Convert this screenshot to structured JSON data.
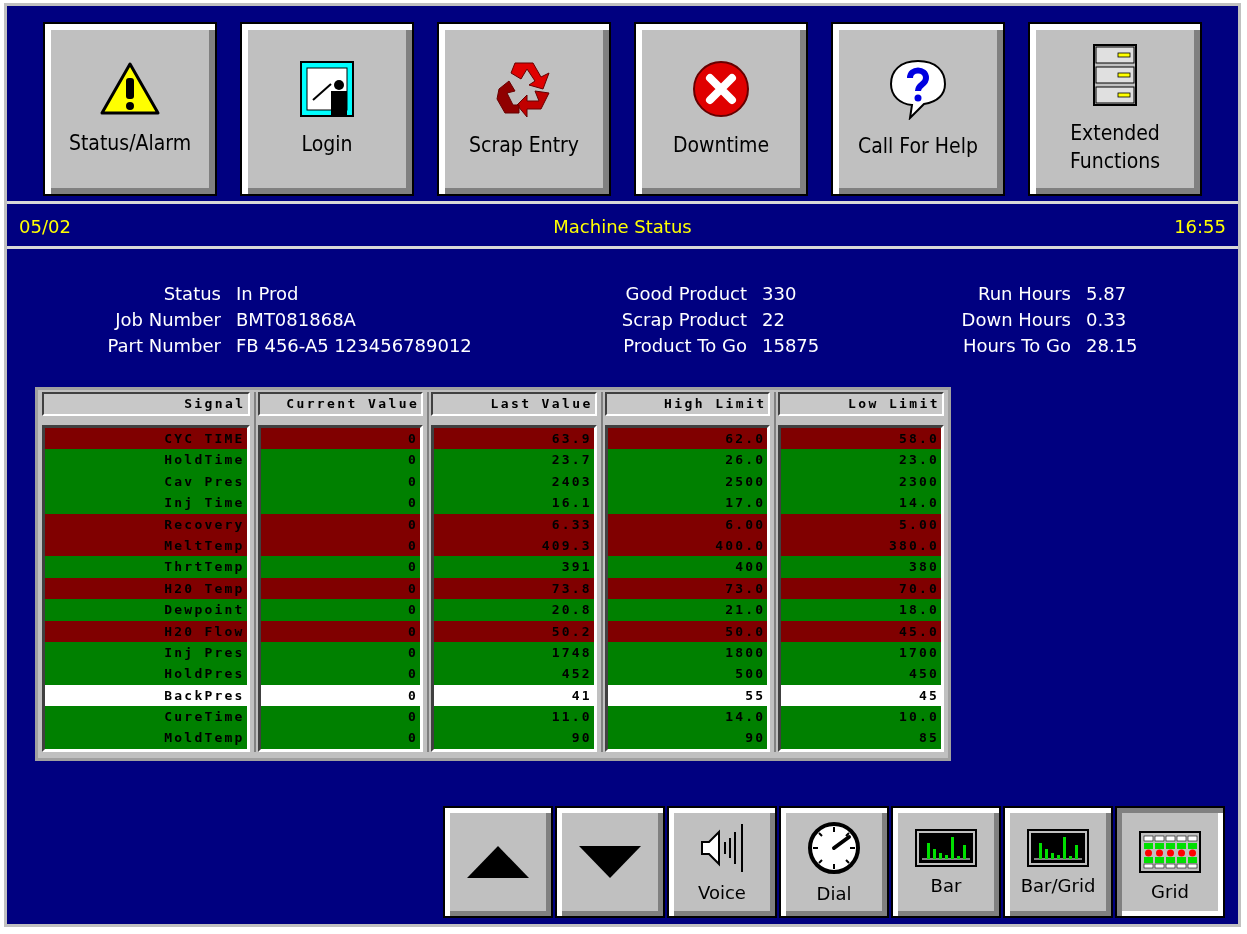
{
  "toolbar": [
    {
      "label": "Status/Alarm"
    },
    {
      "label": "Login"
    },
    {
      "label": "Scrap Entry"
    },
    {
      "label": "Downtime"
    },
    {
      "label": "Call For Help"
    },
    {
      "label": "Extended Functions"
    }
  ],
  "header": {
    "date": "05/02",
    "title": "Machine Status",
    "time": "16:55"
  },
  "info": [
    [
      {
        "label": "Status",
        "value": "In Prod"
      },
      {
        "label": "Job Number",
        "value": "BMT081868A"
      },
      {
        "label": "Part Number",
        "value": "FB 456-A5 123456789012"
      }
    ],
    [
      {
        "label": "Good Product",
        "value": "330"
      },
      {
        "label": "Scrap Product",
        "value": "22"
      },
      {
        "label": "Product To Go",
        "value": "15875"
      }
    ],
    [
      {
        "label": "Run Hours",
        "value": "5.87"
      },
      {
        "label": "Down Hours",
        "value": "0.33"
      },
      {
        "label": "Hours To Go",
        "value": "28.15"
      }
    ]
  ],
  "table": {
    "columns": [
      "Signal",
      "Current Value",
      "Last Value",
      "High Limit",
      "Low Limit"
    ],
    "rows": [
      {
        "color": "#800000",
        "cells": [
          "CYC TIME",
          "0",
          "63.9",
          "62.0",
          "58.0"
        ]
      },
      {
        "color": "#008000",
        "cells": [
          "HoldTime",
          "0",
          "23.7",
          "26.0",
          "23.0"
        ]
      },
      {
        "color": "#008000",
        "cells": [
          "Cav Pres",
          "0",
          "2403",
          "2500",
          "2300"
        ]
      },
      {
        "color": "#008000",
        "cells": [
          "Inj Time",
          "0",
          "16.1",
          "17.0",
          "14.0"
        ]
      },
      {
        "color": "#800000",
        "cells": [
          "Recovery",
          "0",
          "6.33",
          "6.00",
          "5.00"
        ]
      },
      {
        "color": "#800000",
        "cells": [
          "MeltTemp",
          "0",
          "409.3",
          "400.0",
          "380.0"
        ]
      },
      {
        "color": "#008000",
        "cells": [
          "ThrtTemp",
          "0",
          "391",
          "400",
          "380"
        ]
      },
      {
        "color": "#800000",
        "cells": [
          "H20 Temp",
          "0",
          "73.8",
          "73.0",
          "70.0"
        ]
      },
      {
        "color": "#008000",
        "cells": [
          "Dewpoint",
          "0",
          "20.8",
          "21.0",
          "18.0"
        ]
      },
      {
        "color": "#800000",
        "cells": [
          "H20 Flow",
          "0",
          "50.2",
          "50.0",
          "45.0"
        ]
      },
      {
        "color": "#008000",
        "cells": [
          "Inj Pres",
          "0",
          "1748",
          "1800",
          "1700"
        ]
      },
      {
        "color": "#008000",
        "cells": [
          "HoldPres",
          "0",
          "452",
          "500",
          "450"
        ]
      },
      {
        "color": "#ffffff",
        "cells": [
          "BackPres",
          "0",
          "41",
          "55",
          "45"
        ]
      },
      {
        "color": "#008000",
        "cells": [
          "CureTime",
          "0",
          "11.0",
          "14.0",
          "10.0"
        ]
      },
      {
        "color": "#008000",
        "cells": [
          "MoldTemp",
          "0",
          "90",
          "90",
          "85"
        ]
      }
    ]
  },
  "view_buttons": [
    {
      "kind": "up",
      "selected": false
    },
    {
      "kind": "down",
      "selected": false
    },
    {
      "kind": "voice",
      "label": "Voice",
      "selected": false
    },
    {
      "kind": "dial",
      "label": "Dial",
      "selected": false
    },
    {
      "kind": "bar",
      "label": "Bar",
      "selected": false
    },
    {
      "kind": "bargrid",
      "label": "Bar/Grid",
      "selected": false
    },
    {
      "kind": "grid",
      "label": "Grid",
      "selected": true
    }
  ]
}
